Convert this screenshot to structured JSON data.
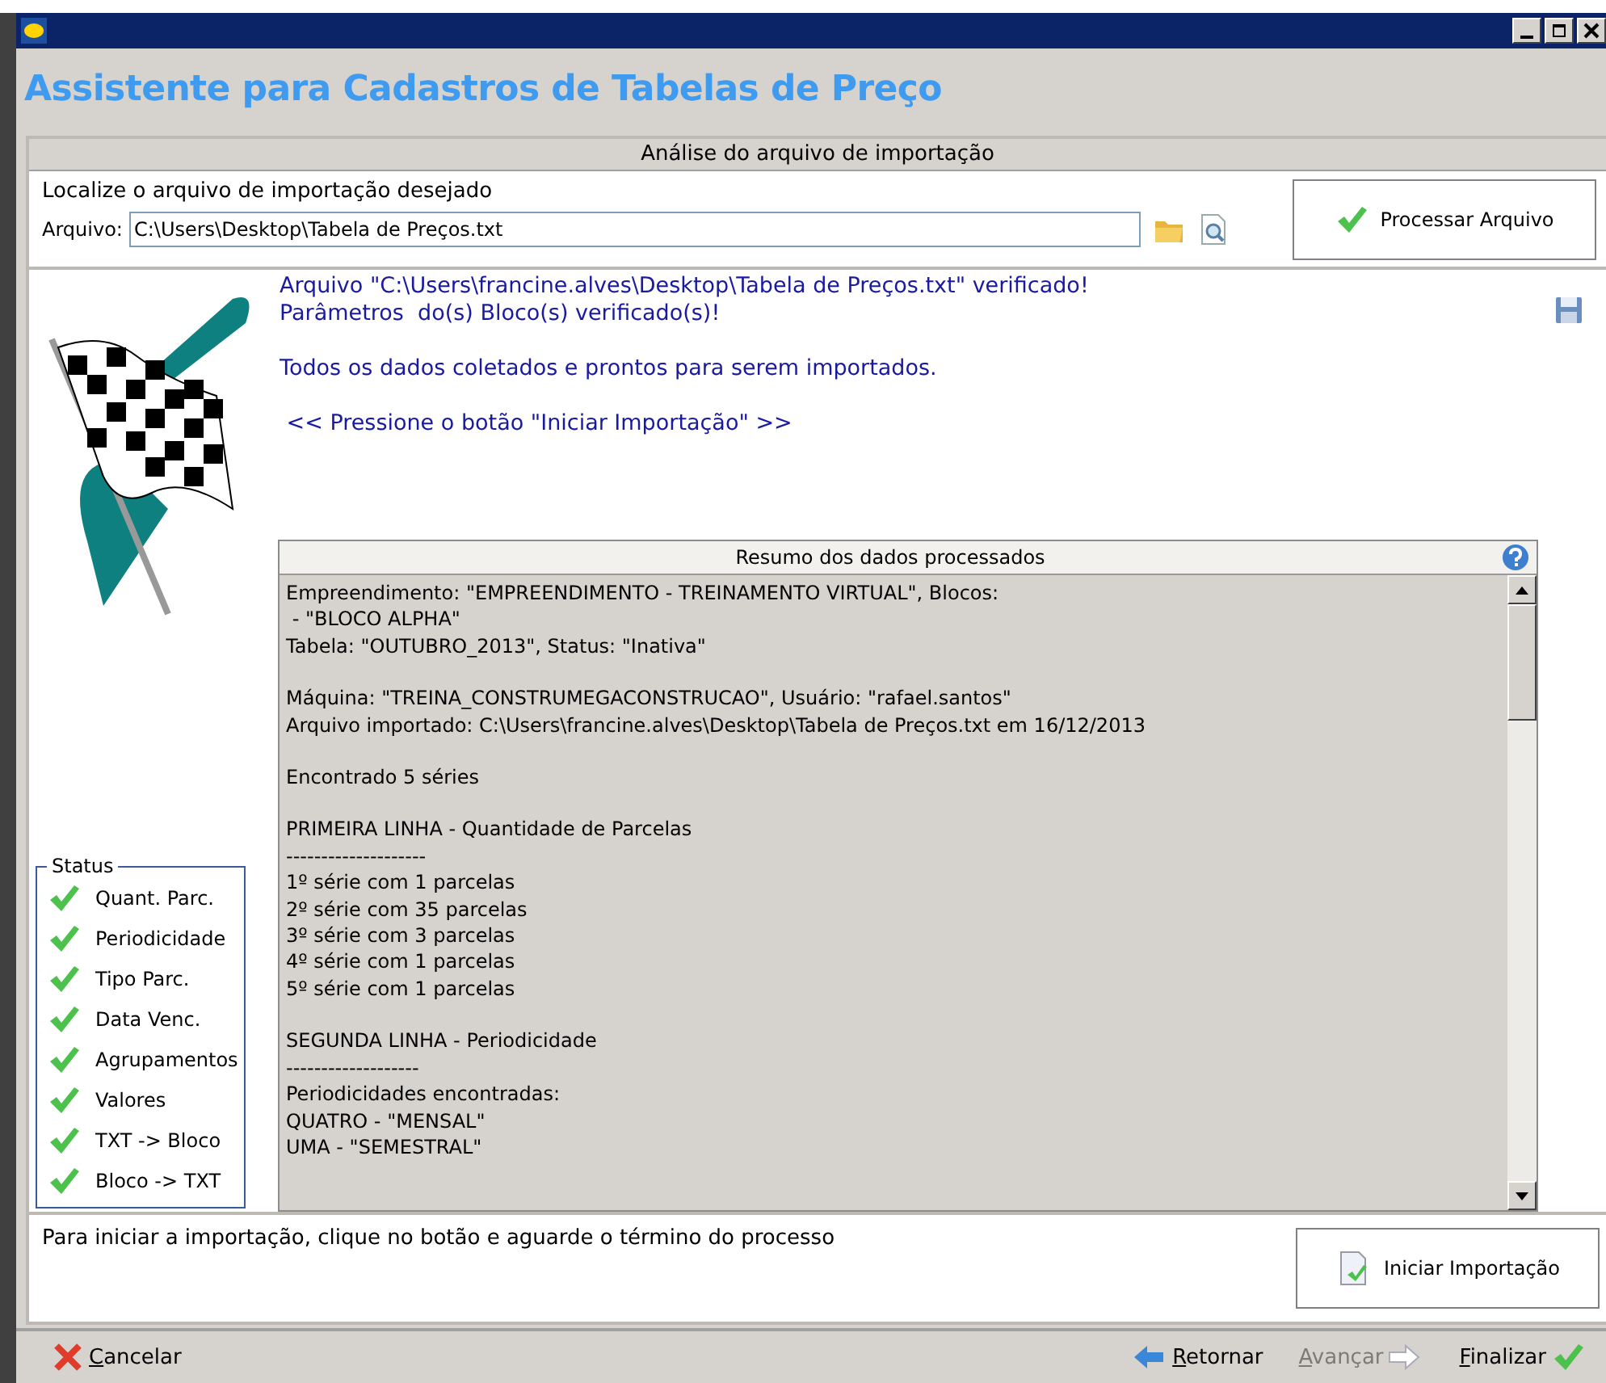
{
  "window": {
    "title": "Assistente para Cadastros de Tabelas de Preço"
  },
  "section_header": "Análise do arquivo de importação",
  "file_prompt": "Localize o arquivo de importação desejado",
  "file_field": {
    "label": "Arquivo:",
    "value": "C:\\Users\\Desktop\\Tabela de Preços.txt"
  },
  "process_button": "Processar Arquivo",
  "messages": [
    [
      "Arquivo \"C:\\Users\\francine.alves\\Desktop\\Tabela de Preços.txt\" verificado!",
      "Parâmetros  do(s) Bloco(s) verificado(s)!"
    ],
    [
      "Todos os dados coletados e prontos para serem importados."
    ],
    [
      " << Pressione o botão \"Iniciar Importação\" >>"
    ]
  ],
  "summary": {
    "title": "Resumo dos dados processados",
    "paragraphs": [
      [
        "Empreendimento: \"EMPREENDIMENTO - TREINAMENTO VIRTUAL\", Blocos:",
        " - \"BLOCO ALPHA\"",
        "Tabela: \"OUTUBRO_2013\", Status: \"Inativa\""
      ],
      [
        "Máquina: \"TREINA_CONSTRUMEGACONSTRUCAO\", Usuário: \"rafael.santos\"",
        "Arquivo importado: C:\\Users\\francine.alves\\Desktop\\Tabela de Preços.txt em 16/12/2013"
      ],
      [
        "Encontrado 5 séries"
      ],
      [
        "PRIMEIRA LINHA - Quantidade de Parcelas",
        "--------------------",
        "1º série com 1 parcelas",
        "2º série com 35 parcelas",
        "3º série com 3 parcelas",
        "4º série com 1 parcelas",
        "5º série com 1 parcelas"
      ],
      [
        "SEGUNDA LINHA - Periodicidade",
        "-------------------",
        "Periodicidades encontradas:",
        "QUATRO - \"MENSAL\"",
        "UMA - \"SEMESTRAL\""
      ]
    ]
  },
  "status": {
    "title": "Status",
    "items": [
      {
        "label": "Quant. Parc.",
        "checked": true
      },
      {
        "label": "Periodicidade",
        "checked": true
      },
      {
        "label": "Tipo Parc.",
        "checked": true
      },
      {
        "label": "Data Venc.",
        "checked": true
      },
      {
        "label": "Agrupamentos",
        "checked": true
      },
      {
        "label": "Valores",
        "checked": true
      },
      {
        "label": "TXT -> Bloco",
        "checked": true
      },
      {
        "label": "Bloco -> TXT",
        "checked": true
      }
    ]
  },
  "instruction": "Para iniciar a importação, clique no botão e aguarde o término do processo",
  "start_button": "Iniciar Importação",
  "footer": {
    "cancel": "Cancelar",
    "nav": [
      {
        "kind": "back",
        "label": "Retornar",
        "disabled": false
      },
      {
        "kind": "next",
        "label": "Avançar",
        "disabled": true
      },
      {
        "kind": "finish",
        "label": "Finalizar",
        "disabled": false
      }
    ]
  }
}
